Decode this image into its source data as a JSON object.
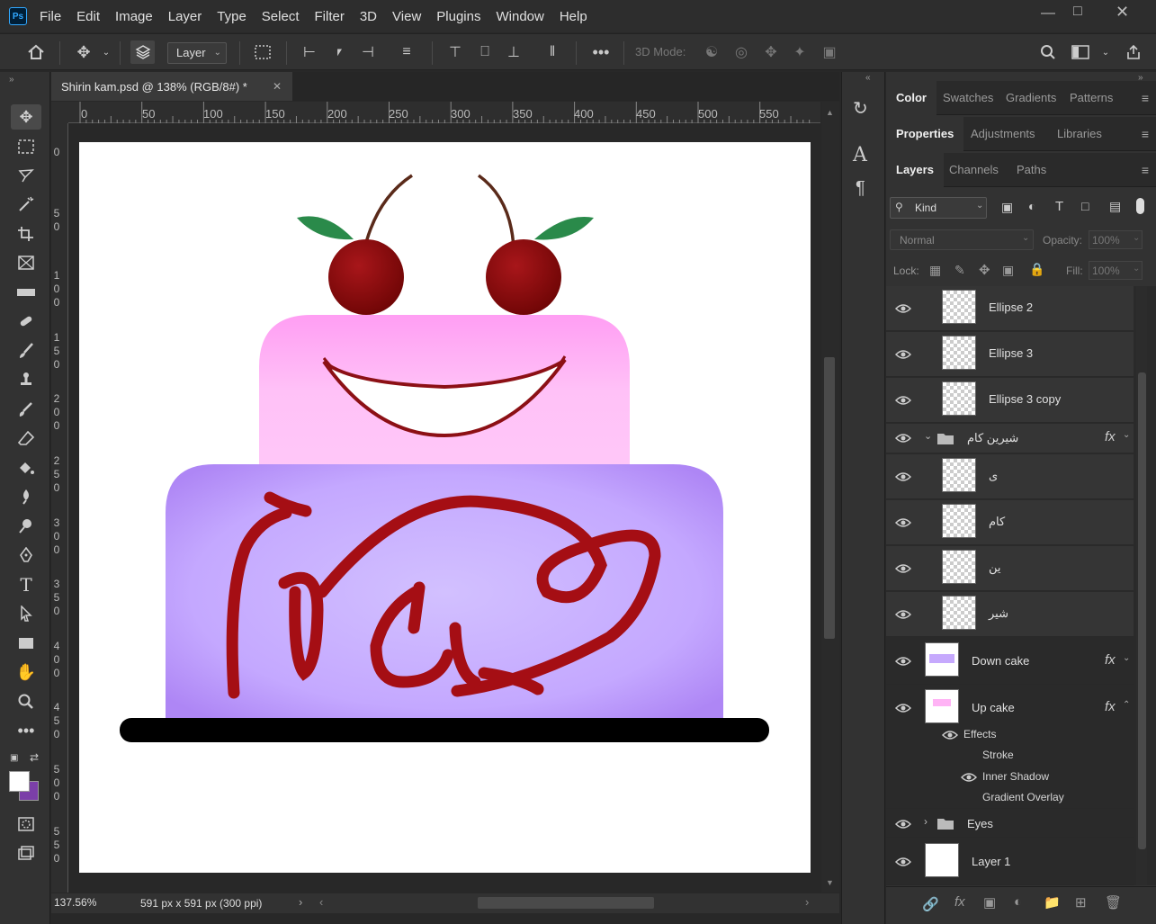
{
  "menubar": {
    "logo": "Ps",
    "items": [
      "File",
      "Edit",
      "Image",
      "Layer",
      "Type",
      "Select",
      "Filter",
      "3D",
      "View",
      "Plugins",
      "Window",
      "Help"
    ]
  },
  "options": {
    "layer_select": "Layer",
    "mode_3d": "3D Mode:"
  },
  "document": {
    "tab_title": "Shirin kam.psd @ 138% (RGB/8#) *",
    "zoom": "137.56%",
    "doc_info": "591 px x 591 px (300 ppi)"
  },
  "ruler": {
    "h_ticks": [
      "0",
      "50",
      "100",
      "150",
      "200",
      "250",
      "300",
      "350",
      "400",
      "450",
      "500",
      "550"
    ],
    "v_ticks": [
      [
        "0"
      ],
      [
        "5",
        "0"
      ],
      [
        "1",
        "0",
        "0"
      ],
      [
        "1",
        "5",
        "0"
      ],
      [
        "2",
        "0",
        "0"
      ],
      [
        "2",
        "5",
        "0"
      ],
      [
        "3",
        "0",
        "0"
      ],
      [
        "3",
        "5",
        "0"
      ],
      [
        "4",
        "0",
        "0"
      ],
      [
        "4",
        "5",
        "0"
      ],
      [
        "5",
        "0",
        "0"
      ],
      [
        "5",
        "5",
        "0"
      ]
    ]
  },
  "panels": {
    "color_tabs": [
      "Color",
      "Swatches",
      "Gradients",
      "Patterns"
    ],
    "props_tabs": [
      "Properties",
      "Adjustments",
      "Libraries"
    ],
    "layers_tabs": [
      "Layers",
      "Channels",
      "Paths"
    ],
    "kind_label": "Kind",
    "blend_mode": "Normal",
    "opacity_label": "Opacity:",
    "opacity_value": "100%",
    "lock_label": "Lock:",
    "fill_label": "Fill:",
    "fill_value": "100%"
  },
  "layers": {
    "ellipse2": "Ellipse 2",
    "ellipse3": "Ellipse 3",
    "ellipse3copy": "Ellipse 3 copy",
    "group_shirin": "شیرین کام",
    "ye": "ی",
    "kam": "کام",
    "yn": "ین",
    "shir": "شیر",
    "down_cake": "Down cake",
    "up_cake": "Up cake",
    "effects": "Effects",
    "stroke": "Stroke",
    "inner_shadow": "Inner Shadow",
    "gradient_overlay": "Gradient Overlay",
    "eyes": "Eyes",
    "layer1": "Layer 1",
    "fx": "fx"
  },
  "colors": {
    "foreground": "#ffffff",
    "background": "#7b3fa8",
    "cake_top": "#ffb3f5",
    "cake_bottom": "#c6a9fd",
    "cherry": "#8c0a0a",
    "script": "#a50e14"
  }
}
